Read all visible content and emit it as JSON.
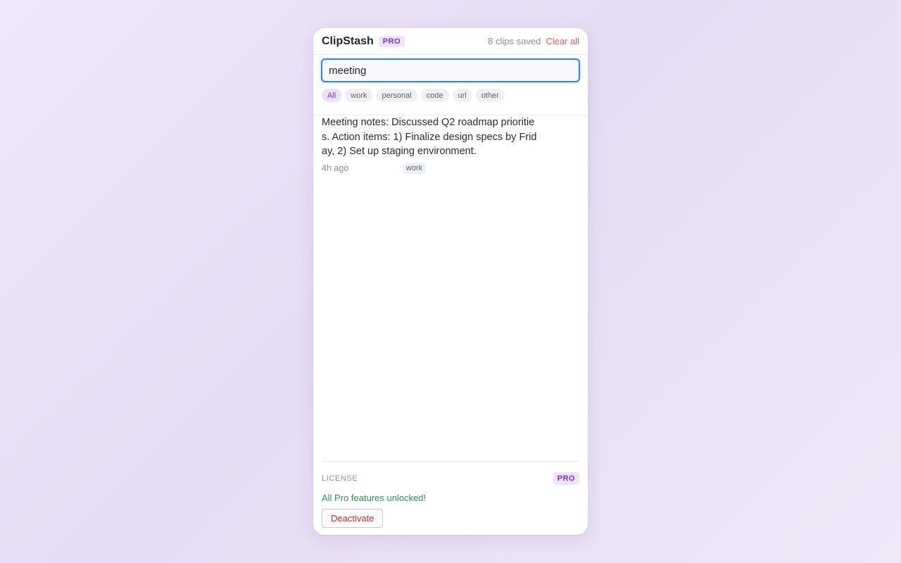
{
  "header": {
    "title": "ClipStash",
    "badge": "PRO",
    "clips_count": "8 clips saved",
    "clear_all": "Clear all"
  },
  "search": {
    "value": "meeting"
  },
  "filters": [
    {
      "label": "All",
      "active": true
    },
    {
      "label": "work",
      "active": false
    },
    {
      "label": "personal",
      "active": false
    },
    {
      "label": "code",
      "active": false
    },
    {
      "label": "url",
      "active": false
    },
    {
      "label": "other",
      "active": false
    }
  ],
  "clips": [
    {
      "text": "Meeting notes: Discussed Q2 roadmap priorities. Action items: 1) Finalize design specs by Friday, 2) Set up staging environment.",
      "time": "4h ago",
      "tag": "work"
    }
  ],
  "license": {
    "label": "LICENSE",
    "badge": "PRO",
    "status": "All Pro features unlocked!",
    "deactivate_label": "Deactivate"
  },
  "colors": {
    "accent": "#7a2ee0",
    "focus": "#3f7fe0",
    "danger": "#ef5b5b",
    "success": "#1e9c4a"
  }
}
